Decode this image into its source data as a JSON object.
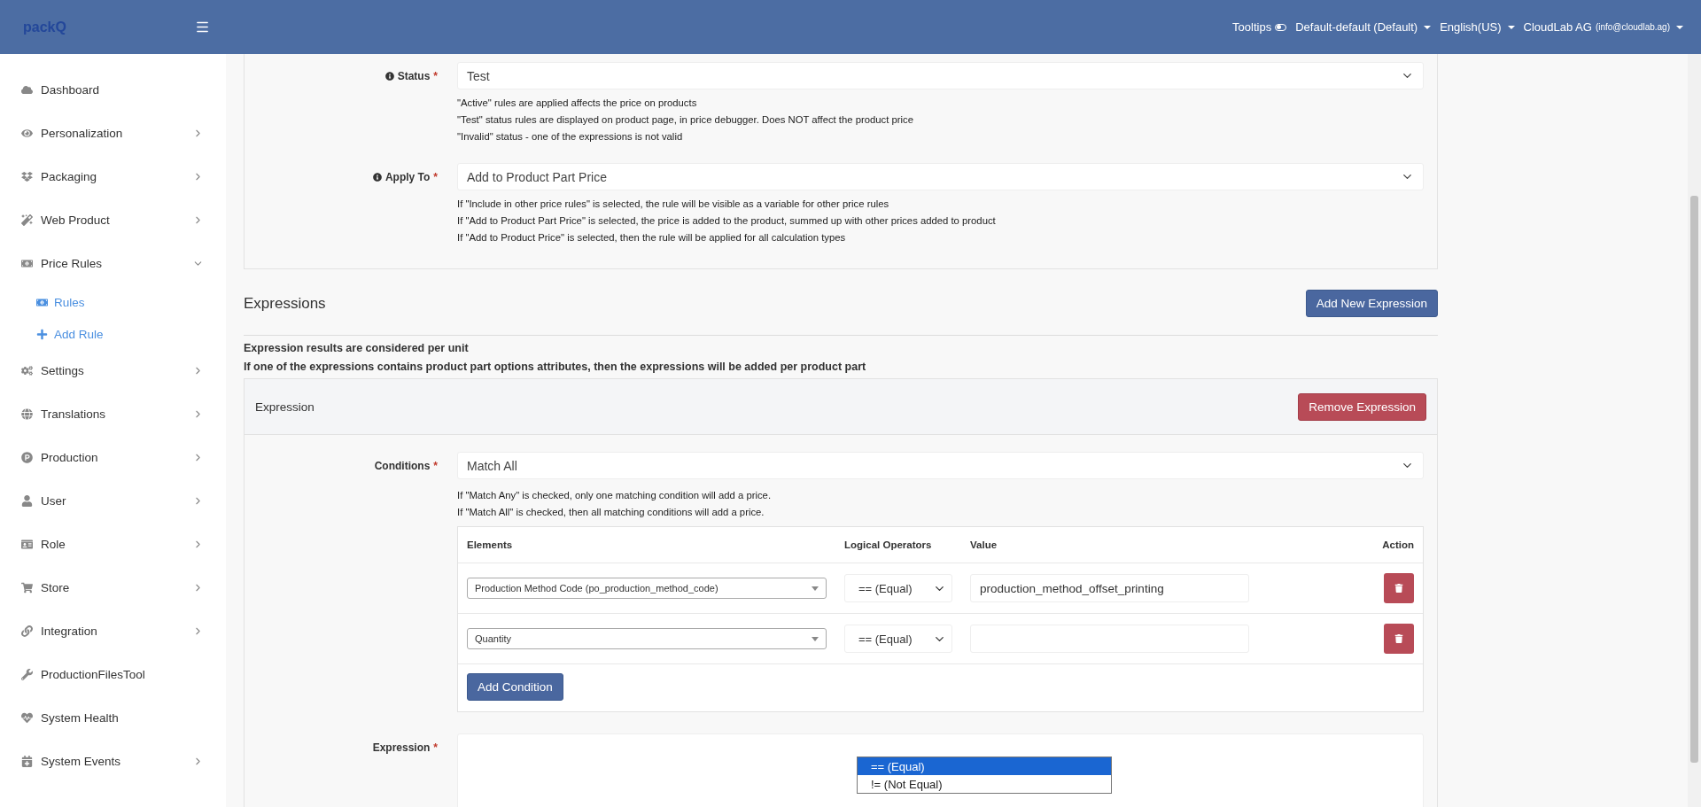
{
  "header": {
    "logo": "packQ",
    "tooltips": {
      "label": "Tooltips",
      "on": false
    },
    "menus": [
      "Default-default (Default)",
      "English(US)"
    ],
    "user": {
      "name": "CloudLab AG",
      "email": "(info@cloudlab.ag)"
    }
  },
  "required_mark": "*",
  "sidebar": {
    "items": [
      {
        "label": "Dashboard",
        "kind": "link"
      },
      {
        "label": "Personalization",
        "kind": "menu",
        "expanded": false
      },
      {
        "label": "Packaging",
        "kind": "menu",
        "expanded": false
      },
      {
        "label": "Web Product",
        "kind": "menu",
        "expanded": false
      },
      {
        "label": "Price Rules",
        "kind": "menu",
        "expanded": true,
        "children": [
          {
            "label": "Rules"
          },
          {
            "label": "Add Rule"
          }
        ]
      },
      {
        "label": "Settings",
        "kind": "menu",
        "expanded": false
      },
      {
        "label": "Translations",
        "kind": "menu",
        "expanded": false
      },
      {
        "label": "Production",
        "kind": "menu",
        "expanded": false
      },
      {
        "label": "User",
        "kind": "menu",
        "expanded": false
      },
      {
        "label": "Role",
        "kind": "menu",
        "expanded": false
      },
      {
        "label": "Store",
        "kind": "menu",
        "expanded": false
      },
      {
        "label": "Integration",
        "kind": "menu",
        "expanded": false
      },
      {
        "label": "ProductionFilesTool",
        "kind": "link"
      },
      {
        "label": "System Health",
        "kind": "link"
      },
      {
        "label": "System Events",
        "kind": "menu",
        "expanded": false
      }
    ]
  },
  "rule_form": {
    "fields": [
      {
        "label": "Status",
        "required": true,
        "value": "Test",
        "help": [
          "\"Active\" rules are applied affects the price on products",
          "\"Test\" status rules are displayed on product page, in price debugger. Does NOT affect the product price",
          "\"Invalid\" status - one of the expressions is not valid"
        ]
      },
      {
        "label": "Apply To",
        "required": true,
        "value": "Add to Product Part Price",
        "help": [
          "If \"Include in other price rules\" is selected, the rule will be visible as a variable for other price rules",
          "If \"Add to Product Part Price\" is selected, the price is added to the product, summed up with other prices added to product",
          "If \"Add to Product Price\" is selected, then the rule will be applied for all calculation types"
        ]
      }
    ]
  },
  "expressions": {
    "title": "Expressions",
    "add_button": "Add New Expression",
    "notes": [
      "Expression results are considered per unit",
      "If one of the expressions contains product part options attributes, then the expressions will be added per product part"
    ],
    "expression": {
      "title": "Expression",
      "remove_button": "Remove Expression",
      "conditions": {
        "label": "Conditions",
        "required": true,
        "value": "Match All",
        "help": [
          "If \"Match Any\" is checked, only one matching condition will add a price.",
          "If \"Match All\" is checked, then all matching conditions will add a price."
        ]
      },
      "table": {
        "columns": [
          "Elements",
          "Logical Operators",
          "Value",
          "Action"
        ],
        "rows": [
          {
            "element": "Production Method Code (po_production_method_code)",
            "operator": "== (Equal)",
            "value": "production_method_offset_printing"
          },
          {
            "element": "Quantity",
            "operator": "== (Equal)",
            "value": ""
          }
        ],
        "add_button": "Add Condition"
      },
      "expression_field": {
        "label": "Expression",
        "required": true
      },
      "operator_list": [
        {
          "label": "== (Equal)",
          "selected": true
        },
        {
          "label": "!= (Not Equal)",
          "selected": false
        }
      ]
    }
  }
}
